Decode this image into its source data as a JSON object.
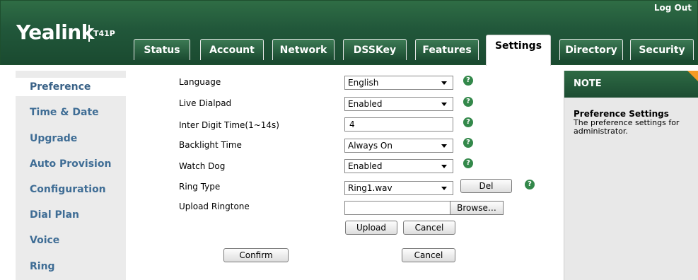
{
  "header": {
    "brand": "Yealink",
    "model": "T41P",
    "logout": "Log Out",
    "tabs": [
      "Status",
      "Account",
      "Network",
      "DSSKey",
      "Features",
      "Settings",
      "Directory",
      "Security"
    ],
    "active_tab": "Settings"
  },
  "sidebar": {
    "items": [
      "Preference",
      "Time & Date",
      "Upgrade",
      "Auto Provision",
      "Configuration",
      "Dial Plan",
      "Voice",
      "Ring"
    ],
    "active": "Preference"
  },
  "form": {
    "language": {
      "label": "Language",
      "value": "English"
    },
    "live_dialpad": {
      "label": "Live Dialpad",
      "value": "Enabled"
    },
    "inter_digit": {
      "label": "Inter Digit Time(1~14s)",
      "value": "4"
    },
    "backlight": {
      "label": "Backlight Time",
      "value": "Always On"
    },
    "watchdog": {
      "label": "Watch Dog",
      "value": "Enabled"
    },
    "ring_type": {
      "label": "Ring Type",
      "value": "Ring1.wav",
      "del_label": "Del"
    },
    "upload_ringtone": {
      "label": "Upload Ringtone",
      "value": "",
      "browse_label": "Browse…",
      "upload_label": "Upload",
      "cancel_label": "Cancel"
    },
    "confirm_label": "Confirm",
    "cancel_label": "Cancel"
  },
  "note": {
    "title": "NOTE",
    "subtitle": "Preference Settings",
    "text": "The preference settings for administrator."
  },
  "colors": {
    "header_green": "#21573a",
    "link_blue": "#3f6d95",
    "help_green": "#33884a",
    "note_accent": "#f59a23"
  }
}
